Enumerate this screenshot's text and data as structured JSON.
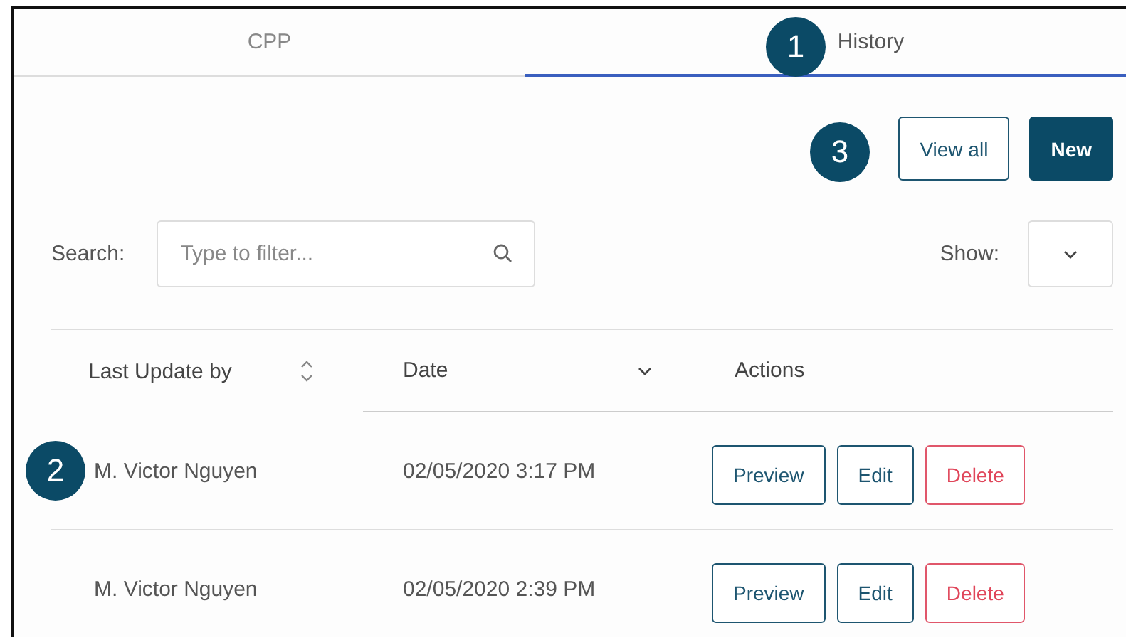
{
  "tabs": [
    {
      "label": "CPP",
      "selected": false
    },
    {
      "label": "History",
      "selected": true
    }
  ],
  "toolbar": {
    "buttons": [
      {
        "label": "View all",
        "kind": "outline"
      },
      {
        "label": "New",
        "kind": "primary"
      }
    ]
  },
  "search": {
    "label": "Search:",
    "placeholder": "Type to filter..."
  },
  "show": {
    "label": "Show:"
  },
  "table": {
    "columns": [
      {
        "label": "Last Update by",
        "kind": "sortable"
      },
      {
        "label": "Date",
        "kind": "sorted"
      },
      {
        "label": "Actions",
        "kind": "plain"
      }
    ],
    "rows": [
      {
        "user": "M. Victor Nguyen",
        "date": "02/05/2020 3:17 PM",
        "actions": [
          {
            "label": "Preview",
            "kind": "outline"
          },
          {
            "label": "Edit",
            "kind": "outline"
          },
          {
            "label": "Delete",
            "kind": "danger"
          }
        ]
      },
      {
        "user": "M. Victor Nguyen",
        "date": "02/05/2020 2:39 PM",
        "actions": [
          {
            "label": "Preview",
            "kind": "outline"
          },
          {
            "label": "Edit",
            "kind": "outline"
          },
          {
            "label": "Delete",
            "kind": "danger"
          }
        ]
      }
    ]
  },
  "callouts": [
    {
      "number": "1"
    },
    {
      "number": "2"
    },
    {
      "number": "3"
    }
  ]
}
